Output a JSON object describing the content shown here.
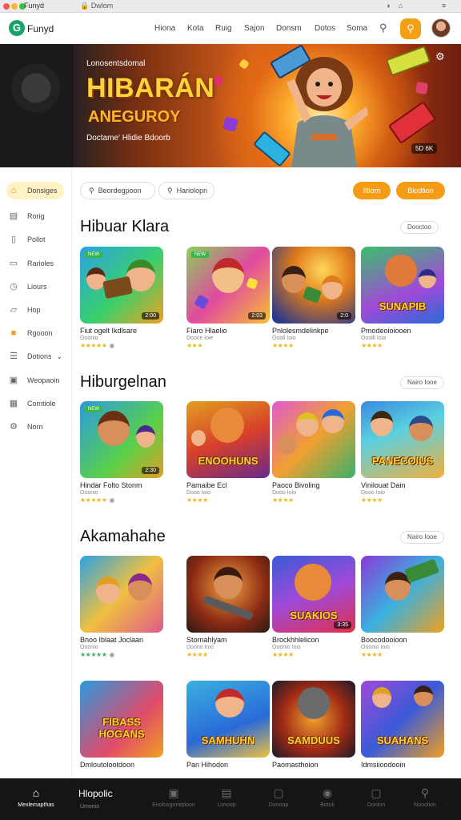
{
  "window": {
    "title": "Funyd",
    "url": "Dwlom",
    "controls": [
      "◑",
      "⌂",
      "≡"
    ]
  },
  "nav": {
    "logo_text": "Funyd",
    "links": [
      "Hiona",
      "Kota",
      "Ruig",
      "Sajon",
      "Donsm",
      "Dotos",
      "Soma"
    ]
  },
  "hero": {
    "kicker": "Lonosentsdomal",
    "title": "HIBARÁN",
    "subtitle": "ANEGUROY",
    "tagline": "Doctame' Hlidie Bdoorb",
    "badge": "5D 6K"
  },
  "sidebar": {
    "items": [
      {
        "label": "Donsiges",
        "icon": "home-icon"
      },
      {
        "label": "Rorig",
        "icon": "calendar-icon"
      },
      {
        "label": "Pollot",
        "icon": "document-icon"
      },
      {
        "label": "Rarioles",
        "icon": "card-icon"
      },
      {
        "label": "Liours",
        "icon": "clock-icon"
      },
      {
        "label": "Hop",
        "icon": "folder-icon"
      },
      {
        "label": "Rgooon",
        "icon": "bag-icon"
      },
      {
        "label": "Dotions",
        "icon": "list-icon"
      },
      {
        "label": "Weopaoin",
        "icon": "window-icon"
      },
      {
        "label": "Comtiole",
        "icon": "grid-icon"
      },
      {
        "label": "Norn",
        "icon": "settings-icon"
      }
    ]
  },
  "filters": {
    "search1": "Beordegpoon",
    "search2": "Hariolopn",
    "btn1": "Iltiom",
    "btn2": "Biodtion"
  },
  "sections": [
    {
      "title": "Hibuar Klara",
      "link": "Dooctoo",
      "cards": [
        {
          "title": "Fiut ogelt Ikdlsare",
          "meta": "Ooonio",
          "badge": "2:00",
          "rating": "★★★★★",
          "thumb_text": ""
        },
        {
          "title": "Fiaro Hlaelio",
          "meta": "Dooce Ioie",
          "badge": "2:03",
          "rating": "★★★",
          "thumb_text": ""
        },
        {
          "title": "Pnlolesmdelinkpe",
          "meta": "Oooll Ioio",
          "badge": "2:0",
          "rating": "★★★★",
          "thumb_text": ""
        },
        {
          "title": "Pmodeoioiooen",
          "meta": "Ooolll Ioia",
          "badge": "",
          "rating": "★★★★",
          "thumb_text": "SUNAPIB"
        }
      ]
    },
    {
      "title": "Hiburgelnan",
      "link": "Nairo Iooe",
      "cards": [
        {
          "title": "Hindar Folto Stonm",
          "meta": "Ooonio",
          "badge": "2:30",
          "rating": "★★★★★",
          "thumb_text": ""
        },
        {
          "title": "Pamaibe Ecl",
          "meta": "Dooo Ioio",
          "badge": "",
          "rating": "★★★★",
          "thumb_text": "ENOOHUNS"
        },
        {
          "title": "Paoco Bivoling",
          "meta": "Dooo Ioio",
          "badge": "",
          "rating": "★★★★",
          "thumb_text": ""
        },
        {
          "title": "Vinilouat Dain",
          "meta": "Dooo Ioio",
          "badge": "",
          "rating": "★★★★",
          "thumb_text": "PANECOIUS"
        }
      ]
    },
    {
      "title": "Akamahahe",
      "link": "Nairo Iooe",
      "cards": [
        {
          "title": "Bnoo Iblaat Joclaan",
          "meta": "Ooonio",
          "badge": "",
          "rating": "★★★★★",
          "thumb_text": ""
        },
        {
          "title": "Stornahlyam",
          "meta": "Doono Ioio",
          "badge": "",
          "rating": "★★★★",
          "thumb_text": ""
        },
        {
          "title": "Brockhhlelicon",
          "meta": "Ooonio Ioio",
          "badge": "3:35",
          "rating": "★★★★",
          "thumb_text": "SUAKIOS"
        },
        {
          "title": "Boocodooioon",
          "meta": "Ooonio Ioio",
          "badge": "",
          "rating": "★★★★",
          "thumb_text": ""
        }
      ]
    },
    {
      "title": "",
      "link": "",
      "cards": [
        {
          "title": "Dmloutolootdoon",
          "meta": "",
          "badge": "",
          "rating": "",
          "thumb_text": "FIBASS HOGANS"
        },
        {
          "title": "Pan Hihodon",
          "meta": "",
          "badge": "",
          "rating": "",
          "thumb_text": "SAMHUHN"
        },
        {
          "title": "Paomasthoion",
          "meta": "",
          "badge": "",
          "rating": "",
          "thumb_text": "SAMDUUS"
        },
        {
          "title": "Idmsiioodooin",
          "meta": "",
          "badge": "",
          "rating": "",
          "thumb_text": "SUAHANS"
        }
      ]
    }
  ],
  "tabbar": {
    "heading": "Hlopolic",
    "heading_sub": "Umonio",
    "tabs": [
      {
        "label": "Mexlemapthas",
        "icon": "home-icon"
      },
      {
        "label": "Eoolosgomiploon",
        "icon": "image-icon"
      },
      {
        "label": "Lonoop",
        "icon": "photo-icon"
      },
      {
        "label": "Donoop",
        "icon": "bookmark-icon"
      },
      {
        "label": "Botoli",
        "icon": "compass-icon"
      },
      {
        "label": "Donlon",
        "icon": "square-icon"
      },
      {
        "label": "Nooolion",
        "icon": "search-icon"
      }
    ]
  }
}
